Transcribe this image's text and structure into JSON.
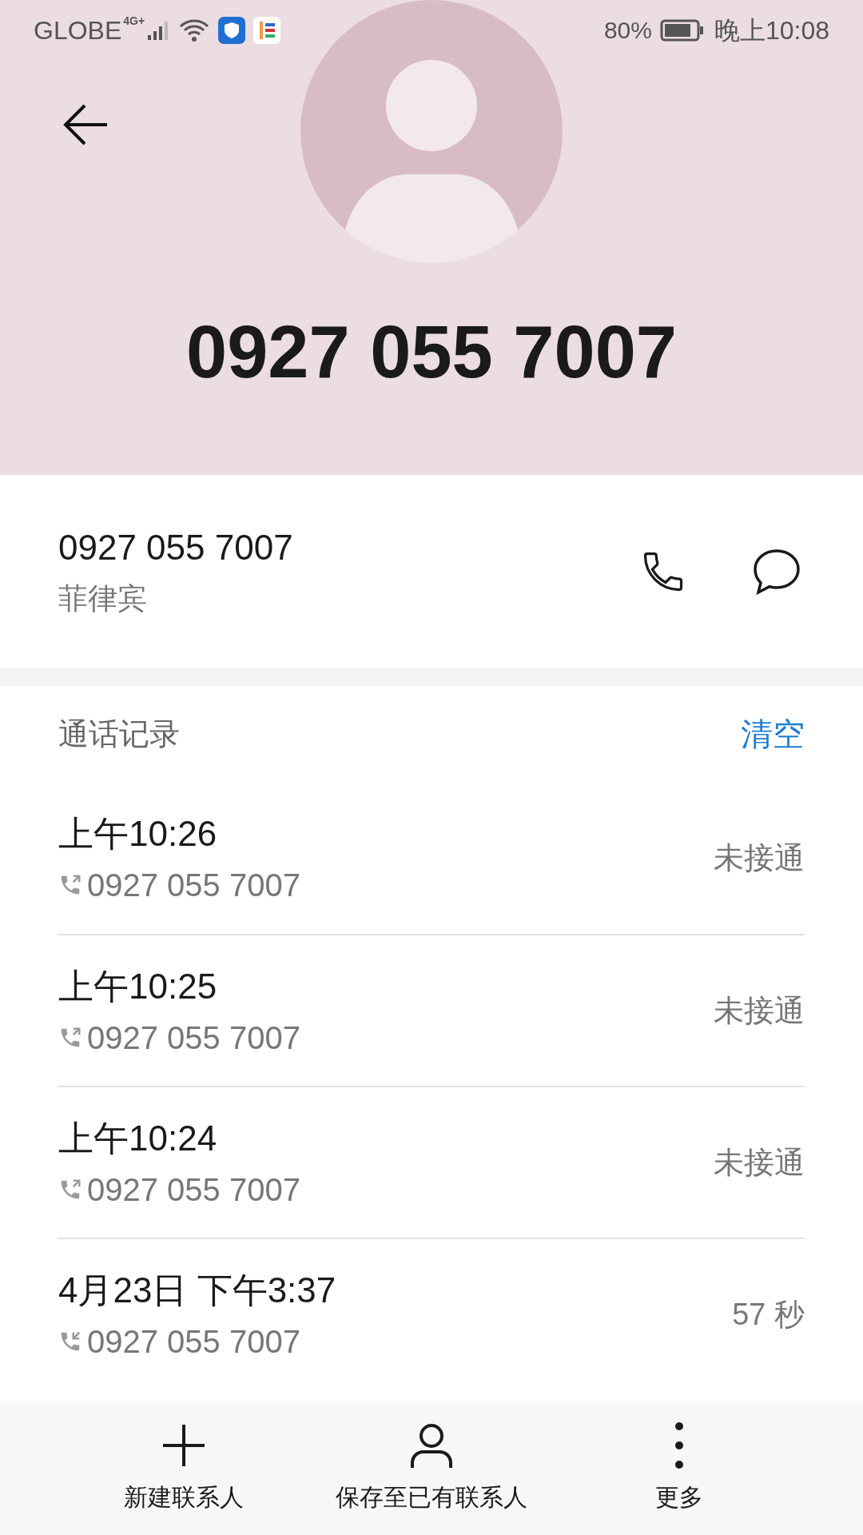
{
  "status_bar": {
    "carrier": "GLOBE",
    "network": "4G+",
    "battery_percent": "80%",
    "time": "晚上10:08"
  },
  "header": {
    "title": "0927 055 7007"
  },
  "contact": {
    "number": "0927 055 7007",
    "location": "菲律宾"
  },
  "call_log": {
    "title": "通话记录",
    "clear": "清空",
    "entries": [
      {
        "time": "上午10:26",
        "number": "0927 055 7007",
        "kind": "outgoing",
        "result": "未接通"
      },
      {
        "time": "上午10:25",
        "number": "0927 055 7007",
        "kind": "outgoing",
        "result": "未接通"
      },
      {
        "time": "上午10:24",
        "number": "0927 055 7007",
        "kind": "outgoing",
        "result": "未接通"
      },
      {
        "time": "4月23日 下午3:37",
        "number": "0927 055 7007",
        "kind": "incoming",
        "result": "57 秒"
      }
    ]
  },
  "bottom_bar": [
    {
      "kind": "add",
      "label": "新建联系人"
    },
    {
      "kind": "person",
      "label": "保存至已有联系人"
    },
    {
      "kind": "more",
      "label": "更多"
    }
  ]
}
